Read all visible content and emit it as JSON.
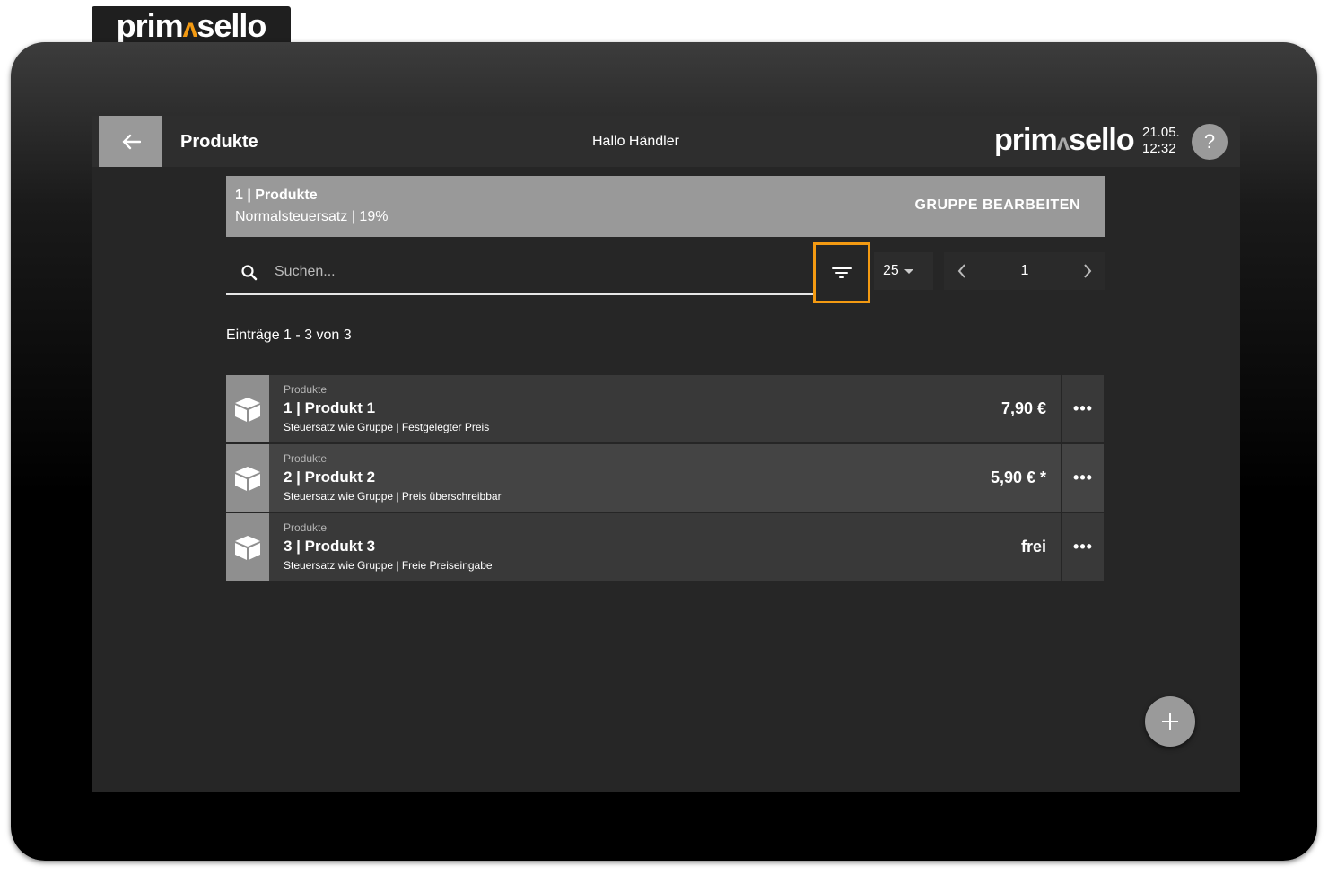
{
  "brand": {
    "logo_prefix": "prim",
    "logo_accent": "ʌ",
    "logo_suffix": "sello"
  },
  "header": {
    "title": "Produkte",
    "greeting": "Hallo Händler",
    "logo_prefix": "prim",
    "logo_accent": "ʌ",
    "logo_suffix": "sello",
    "date": "21.05.",
    "time": "12:32",
    "help_label": "?"
  },
  "group": {
    "title": "1 | Produkte",
    "subtitle": "Normalsteuersatz | 19%",
    "edit_label": "GRUPPE BEARBEITEN"
  },
  "search": {
    "placeholder": "Suchen...",
    "value": ""
  },
  "pagination": {
    "per_page": "25",
    "current_page": "1"
  },
  "entries_text": "Einträge 1 - 3 von 3",
  "products": [
    {
      "category": "Produkte",
      "name": "1 | Produkt 1",
      "description": "Steuersatz wie Gruppe | Festgelegter Preis",
      "price": "7,90 €",
      "more": "•••"
    },
    {
      "category": "Produkte",
      "name": "2 | Produkt 2",
      "description": "Steuersatz wie Gruppe | Preis überschreibbar",
      "price": "5,90 € *",
      "more": "•••"
    },
    {
      "category": "Produkte",
      "name": "3 | Produkt 3",
      "description": "Steuersatz wie Gruppe | Freie Preiseingabe",
      "price": "frei",
      "more": "•••"
    }
  ],
  "icons": {
    "back": "arrow-left-icon",
    "search": "search-icon",
    "filter": "filter-icon",
    "prev": "chevron-left-icon",
    "next": "chevron-right-icon",
    "product": "box-icon",
    "add": "plus-icon"
  },
  "colors": {
    "accent": "#f39a12",
    "group_bar": "#999999",
    "background": "#262626"
  }
}
